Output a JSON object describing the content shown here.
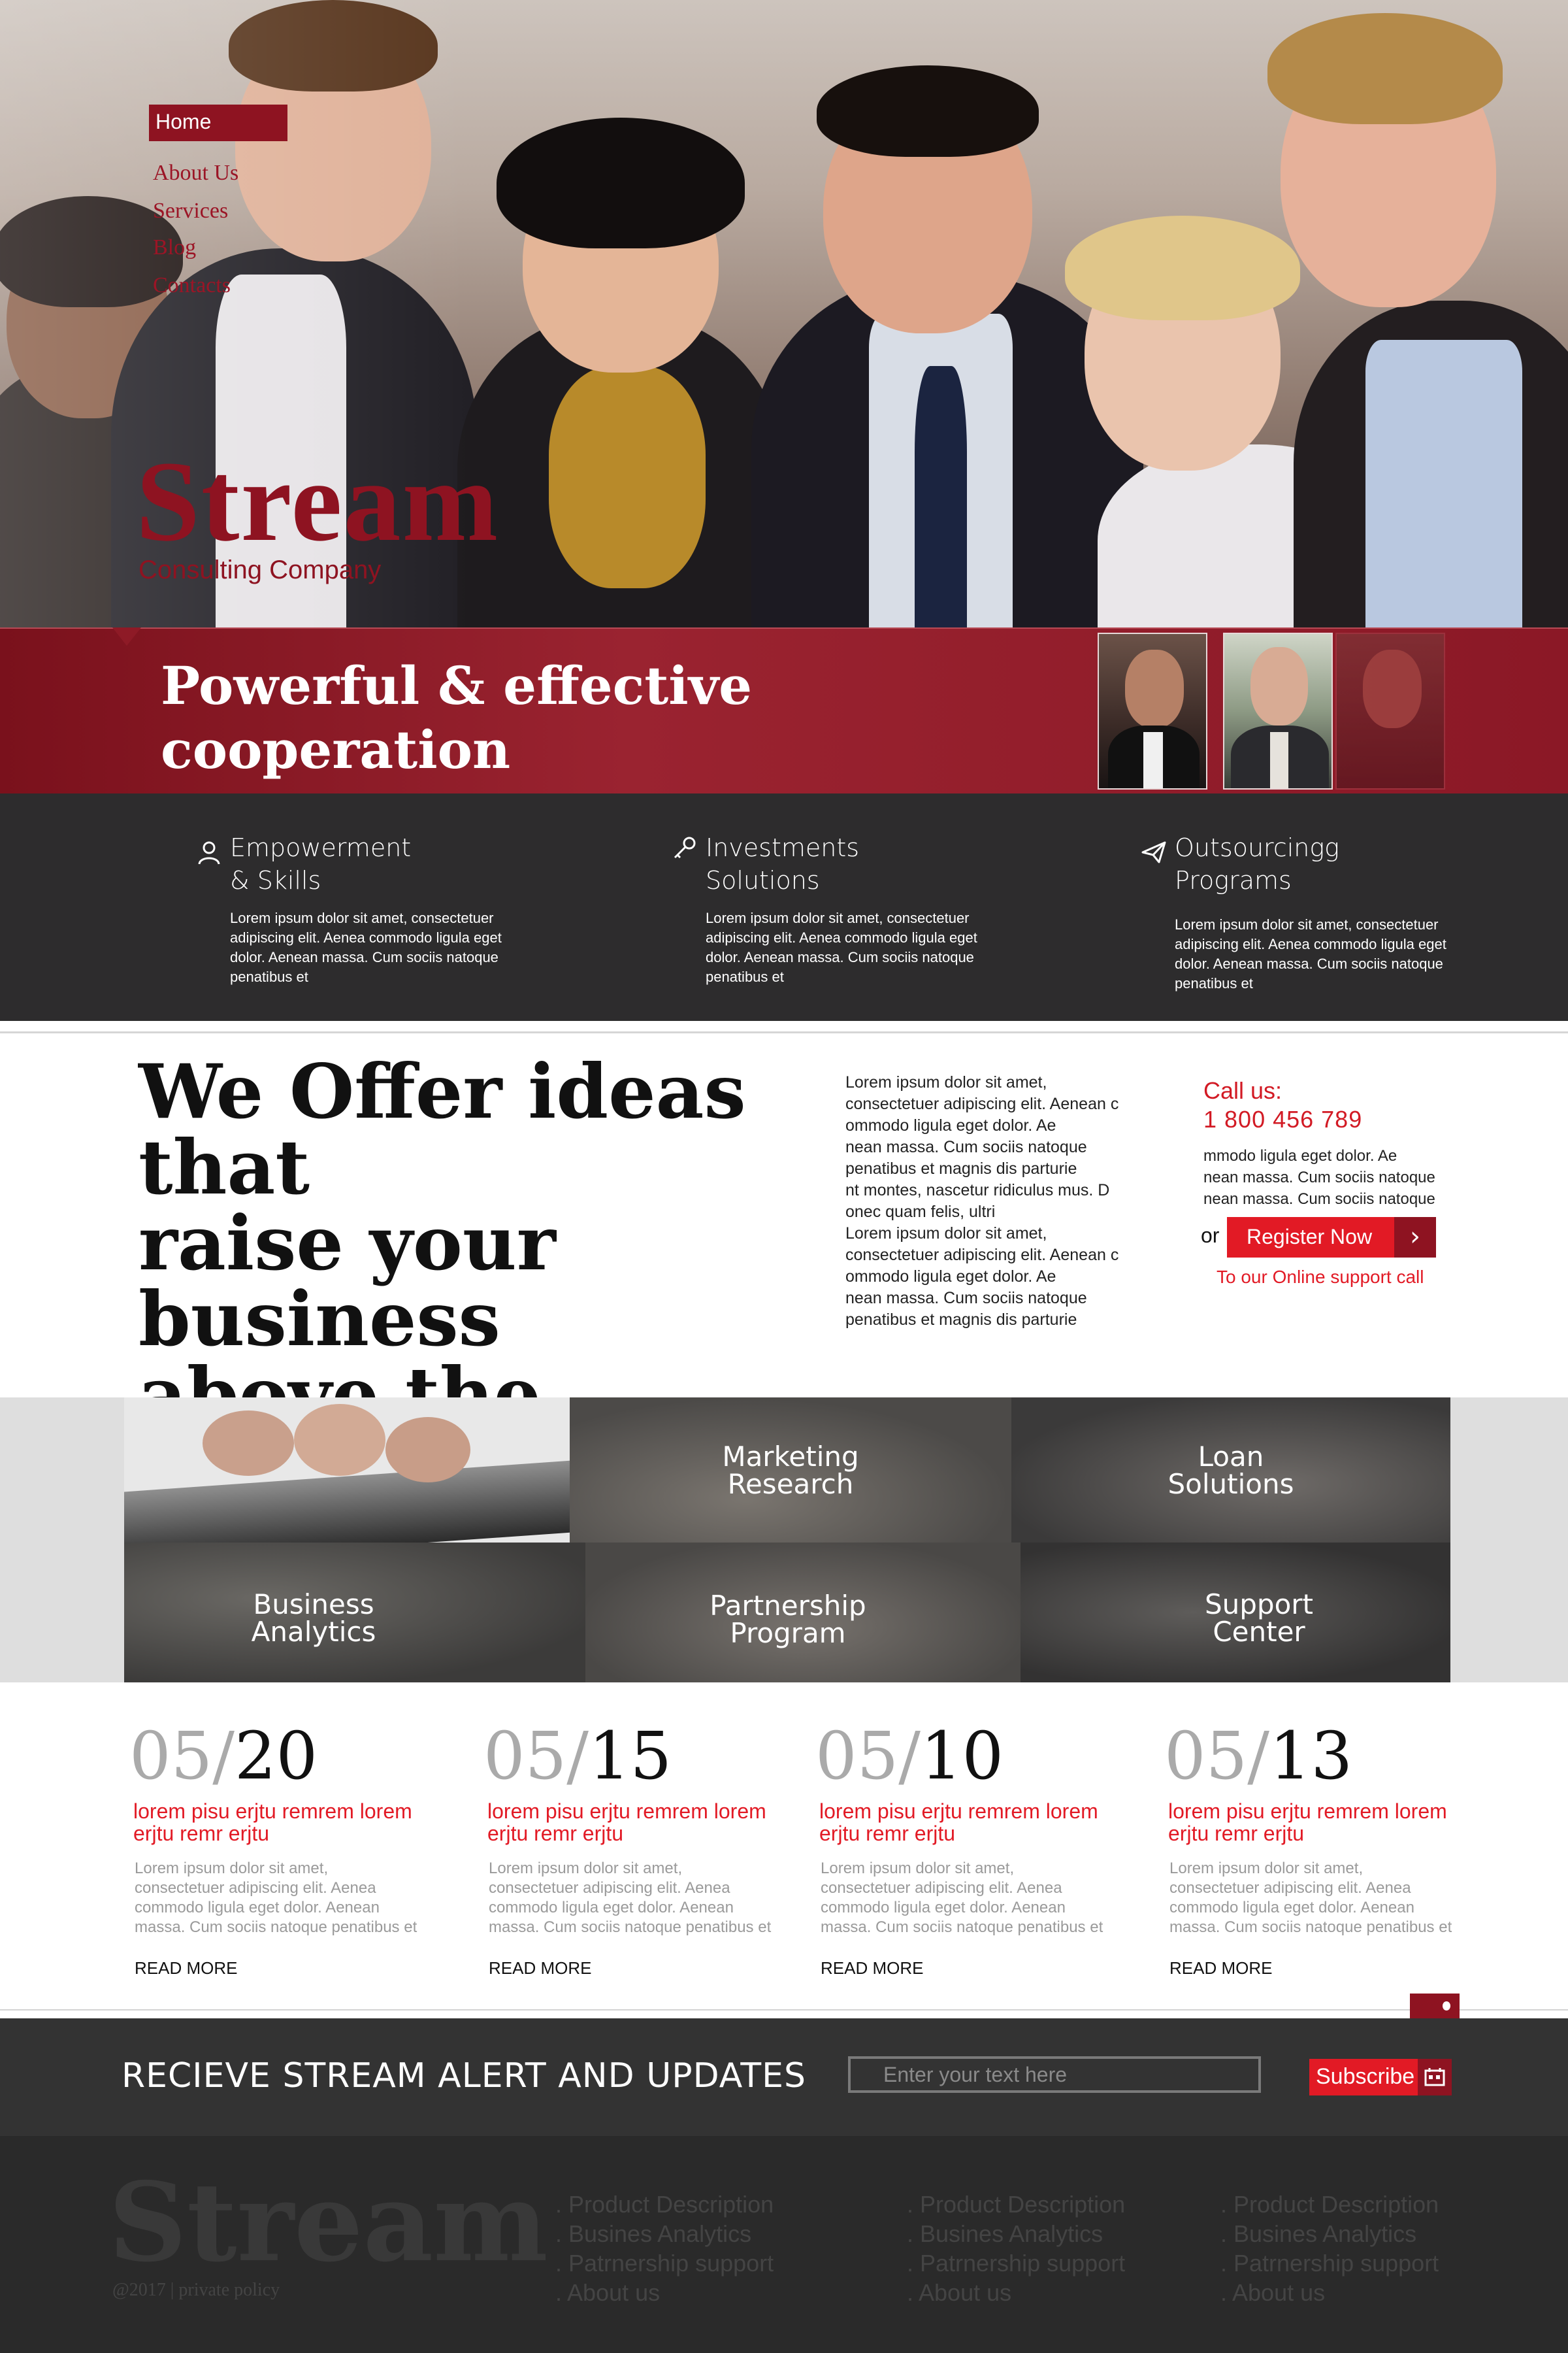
{
  "nav": {
    "items": [
      {
        "label": "Home",
        "active": true
      },
      {
        "label": "About Us"
      },
      {
        "label": "Services"
      },
      {
        "label": "Blog"
      },
      {
        "label": "Contacts"
      }
    ]
  },
  "brand": {
    "name": "Stream",
    "tagline": "Consulting Company"
  },
  "banner": {
    "title_line1": "Powerful  & effective",
    "title_line2": "cooperation"
  },
  "services": [
    {
      "icon": "user-icon",
      "title_line1": "Empowerment",
      "title_line2": "& Skills",
      "text": "Lorem ipsum dolor sit amet, consectetuer adipiscing elit. Aenea commodo ligula eget dolor. Aenean massa. Cum sociis natoque penatibus et"
    },
    {
      "icon": "key-icon",
      "title_line1": "Investments",
      "title_line2": "Solutions",
      "text": "Lorem ipsum dolor sit amet, consectetuer adipiscing elit. Aenea commodo ligula eget dolor. Aenean massa. Cum sociis natoque penatibus et"
    },
    {
      "icon": "paper-plane-icon",
      "title_line1": "Outsourcingg",
      "title_line2": "Programs",
      "text": "Lorem ipsum dolor sit amet, consectetuer adipiscing elit. Aenea commodo ligula eget dolor. Aenean massa. Cum sociis natoque penatibus et"
    }
  ],
  "offer": {
    "title_line1": "We Offer ideas that",
    "title_line2": "raise your business",
    "title_line3": "above the expected",
    "text_lines": [
      "Lorem ipsum dolor sit amet,",
      "consectetuer adipiscing elit. Aenean c",
      "ommodo ligula eget dolor. Ae",
      "nean massa. Cum sociis natoque",
      " penatibus et magnis dis parturie",
      "nt montes, nascetur ridiculus mus. D",
      "onec quam felis, ultri",
      "Lorem ipsum dolor sit amet,",
      "consectetuer adipiscing elit. Aenean c",
      "ommodo ligula eget dolor. Ae",
      "nean massa. Cum sociis natoque",
      " penatibus et magnis dis parturie"
    ]
  },
  "contact": {
    "call_label": "Call us:",
    "phone": "1 800 456 789",
    "text_lines": [
      "mmodo ligula eget dolor. Ae",
      "nean massa. Cum sociis natoque",
      "nean massa. Cum sociis natoque"
    ],
    "or_label": "or",
    "register_label": "Register Now",
    "support_text": "To our Online support call"
  },
  "tiles": [
    {
      "line1": "Marketing",
      "line2": "Research"
    },
    {
      "line1": "Loan",
      "line2": "Solutions"
    },
    {
      "line1": "Business",
      "line2": "Analytics"
    },
    {
      "line1": "Partnership",
      "line2": "Program"
    },
    {
      "line1": "Support",
      "line2": "Center"
    }
  ],
  "news": [
    {
      "month": "05/",
      "day": "20",
      "title": "lorem pisu erjtu remrem lorem erjtu remr  erjtu",
      "text": "Lorem ipsum dolor sit amet, consectetuer adipiscing elit. Aenea commodo ligula eget dolor. Aenean massa. Cum sociis natoque penatibus et",
      "more": "READ MORE"
    },
    {
      "month": "05/",
      "day": "15",
      "title": "lorem pisu erjtu remrem lorem erjtu remr  erjtu",
      "text": "Lorem ipsum dolor sit amet, consectetuer adipiscing elit. Aenea commodo ligula eget dolor. Aenean massa. Cum sociis natoque penatibus et",
      "more": "READ MORE"
    },
    {
      "month": "05/",
      "day": "10",
      "title": "lorem pisu erjtu remrem lorem erjtu remr  erjtu",
      "text": "Lorem ipsum dolor sit amet, consectetuer adipiscing elit. Aenea commodo ligula eget dolor. Aenean massa. Cum sociis natoque penatibus et",
      "more": "READ MORE"
    },
    {
      "month": "05/",
      "day": "13",
      "title": "lorem pisu erjtu remrem lorem erjtu remr  erjtu",
      "text": "Lorem ipsum dolor sit amet, consectetuer adipiscing elit. Aenea commodo ligula eget dolor. Aenean massa. Cum sociis natoque penatibus et",
      "more": "READ MORE"
    }
  ],
  "subscribe": {
    "title": "RECIEVE STREAM ALERT AND UPDATES",
    "placeholder": "Enter your text here",
    "button_label": "Subscribe"
  },
  "footer": {
    "logo": "Stream",
    "copyright": "@2017 | private policy",
    "columns": [
      [
        ". Product Description",
        ". Busines  Analytics",
        ". Patrnership support",
        ". About us"
      ],
      [
        ". Product Description",
        ". Busines  Analytics",
        ". Patrnership support",
        ". About us"
      ],
      [
        ". Product Description",
        ". Busines  Analytics",
        ". Patrnership support",
        ". About us"
      ]
    ]
  },
  "colors": {
    "accent": "#8e1321",
    "red": "#e21a25",
    "dark": "#2d2c2d"
  }
}
